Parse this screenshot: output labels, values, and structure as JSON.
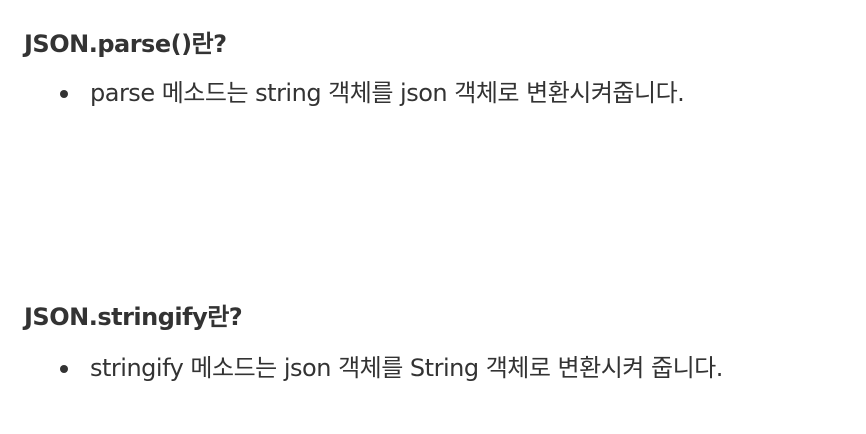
{
  "sections": [
    {
      "heading": "JSON.parse()란?",
      "items": [
        "parse 메소드는 string 객체를 json 객체로 변환시켜줍니다."
      ]
    },
    {
      "heading": "JSON.stringify란?",
      "items": [
        "stringify 메소드는 json 객체를 String 객체로 변환시켜 줍니다."
      ]
    }
  ],
  "colors": {
    "text": "#333333",
    "background": "#ffffff"
  }
}
